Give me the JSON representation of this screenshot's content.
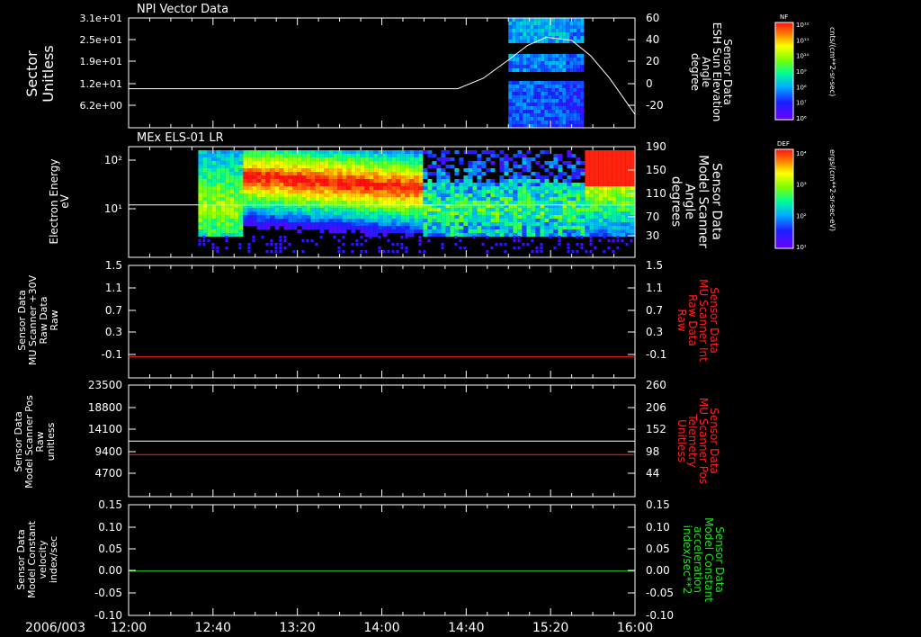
{
  "x_axis": {
    "date_label": "2006/003",
    "ticks": [
      "12:00",
      "12:40",
      "13:20",
      "14:00",
      "14:40",
      "15:20",
      "16:00"
    ],
    "range": [
      "12:00",
      "16:00"
    ]
  },
  "colors": {
    "background": "#000000",
    "axis": "#ffffff",
    "red_series": "#ff2020",
    "green_series": "#20e020",
    "white_series": "#ffffff"
  },
  "panels": [
    {
      "id": "panel1",
      "title": "NPI Vector Data",
      "left_label": [
        "Sector",
        "Unitless"
      ],
      "left_ticks": [
        "3.1e+01",
        "2.5e+01",
        "1.9e+01",
        "1.2e+01",
        "6.2e+00"
      ],
      "right_label": [
        "Sensor Data",
        "ESH Sun Elevation",
        "Angle",
        "degree"
      ],
      "right_label_color": "#ffffff",
      "right_ticks": [
        "60",
        "40",
        "20",
        "0",
        "-20"
      ],
      "right_range": [
        -38,
        60
      ],
      "colorbar": {
        "label": "NF",
        "units": "cnts/(cm**2-sr-sec)",
        "tick_labels": [
          "10¹²",
          "10¹¹",
          "10¹⁰",
          "10⁹",
          "10⁸",
          "10⁷",
          "10⁶"
        ]
      }
    },
    {
      "id": "panel2",
      "title": "MEx ELS-01 LR",
      "left_label": [
        "Electron Energy",
        "eV"
      ],
      "left_ticks": [
        "10²",
        "10¹"
      ],
      "right_label": [
        "Sensor Data",
        "Model Scanner",
        "Angle",
        "degrees"
      ],
      "right_label_color": "#ffffff",
      "right_ticks": [
        "190",
        "150",
        "110",
        "70",
        "30"
      ],
      "right_range": [
        0,
        190
      ],
      "colorbar": {
        "label": "DEF",
        "units": "ergs/(cm**2-sr-sec-eV)",
        "tick_labels": [
          "10⁴",
          "10³",
          "10²",
          "10¹"
        ]
      }
    },
    {
      "id": "panel3",
      "left_label": [
        "Sensor Data",
        "MU Scanner +30V",
        "Raw Data",
        "Raw"
      ],
      "left_ticks": [
        "1.5",
        "1.1",
        "0.7",
        "0.3",
        "-0.1"
      ],
      "left_range": [
        -0.35,
        1.5
      ],
      "right_label": [
        "Sensor Data",
        "MU Scanner Int",
        "Raw Data",
        "Raw"
      ],
      "right_label_color": "#ff2020",
      "right_ticks": [
        "1.5",
        "1.1",
        "0.7",
        "0.3",
        "-0.1"
      ]
    },
    {
      "id": "panel4",
      "left_label": [
        "Sensor Data",
        "Model Scanner Pos",
        "Raw",
        "unitless"
      ],
      "left_ticks": [
        "23500",
        "18800",
        "14100",
        "9400",
        "4700"
      ],
      "left_range": [
        0,
        23500
      ],
      "right_label": [
        "Sensor Data",
        "MU Scanner Pos",
        "Telemetry",
        "Unitless"
      ],
      "right_label_color": "#ff2020",
      "right_ticks": [
        "260",
        "206",
        "152",
        "98",
        "44"
      ],
      "right_range": [
        0,
        260
      ]
    },
    {
      "id": "panel5",
      "left_label": [
        "Sensor Data",
        "Model Constant",
        "velocity",
        "index/sec"
      ],
      "left_ticks": [
        "0.15",
        "0.10",
        "0.05",
        "0.00",
        "-0.05",
        "-0.10"
      ],
      "left_range": [
        -0.1,
        0.15
      ],
      "right_label": [
        "Sensor Data",
        "Model Constant",
        "acceleration",
        "index/sec**2"
      ],
      "right_label_color": "#20e020",
      "right_ticks": [
        "0.15",
        "0.10",
        "0.05",
        "0.00",
        "-0.05",
        "-0.10"
      ],
      "right_range": [
        -0.1,
        0.15
      ]
    }
  ],
  "chart_data": [
    {
      "type": "heatmap",
      "panel": "panel1",
      "title": "NPI Vector Data",
      "ylabel": "Sector Unitless",
      "xlim": [
        "12:00",
        "16:00"
      ],
      "data_time_range": [
        "15:00",
        "15:35"
      ],
      "series": [
        {
          "axis": "right",
          "type": "line",
          "color": "#ffffff",
          "x_hours": [
            12.0,
            14.6,
            14.8,
            15.0,
            15.15,
            15.3,
            15.5,
            15.65,
            15.8,
            16.0
          ],
          "y": [
            0,
            0,
            10,
            28,
            42,
            50,
            47,
            32,
            10,
            -25
          ]
        }
      ]
    },
    {
      "type": "heatmap",
      "panel": "panel2",
      "title": "MEx ELS-01 LR",
      "ylabel": "Electron Energy eV",
      "xlim": [
        "12:00",
        "16:00"
      ],
      "data_time_range": [
        "12:40",
        "16:00"
      ],
      "series": [
        {
          "axis": "right",
          "type": "line",
          "color": "#ffffff",
          "x_hours": [
            12.0,
            16.0
          ],
          "y": [
            90,
            90
          ]
        }
      ]
    },
    {
      "type": "line",
      "panel": "panel3",
      "xlim": [
        "12:00",
        "16:00"
      ],
      "series": [
        {
          "axis": "left",
          "color": "#ff2020",
          "x_hours": [
            12.0,
            16.0
          ],
          "y": [
            0.0,
            0.0
          ]
        }
      ]
    },
    {
      "type": "line",
      "panel": "panel4",
      "xlim": [
        "12:00",
        "16:00"
      ],
      "series": [
        {
          "axis": "left",
          "color": "#ffffff",
          "x_hours": [
            12.0,
            16.0
          ],
          "y": [
            11700,
            11700
          ]
        },
        {
          "axis": "right",
          "color": "#ff2020",
          "x_hours": [
            12.0,
            16.0
          ],
          "y": [
            98,
            98
          ]
        }
      ]
    },
    {
      "type": "line",
      "panel": "panel5",
      "xlim": [
        "12:00",
        "16:00"
      ],
      "series": [
        {
          "axis": "left",
          "color": "#20e020",
          "x_hours": [
            12.0,
            16.0
          ],
          "y": [
            0.0,
            0.0
          ]
        }
      ]
    }
  ]
}
